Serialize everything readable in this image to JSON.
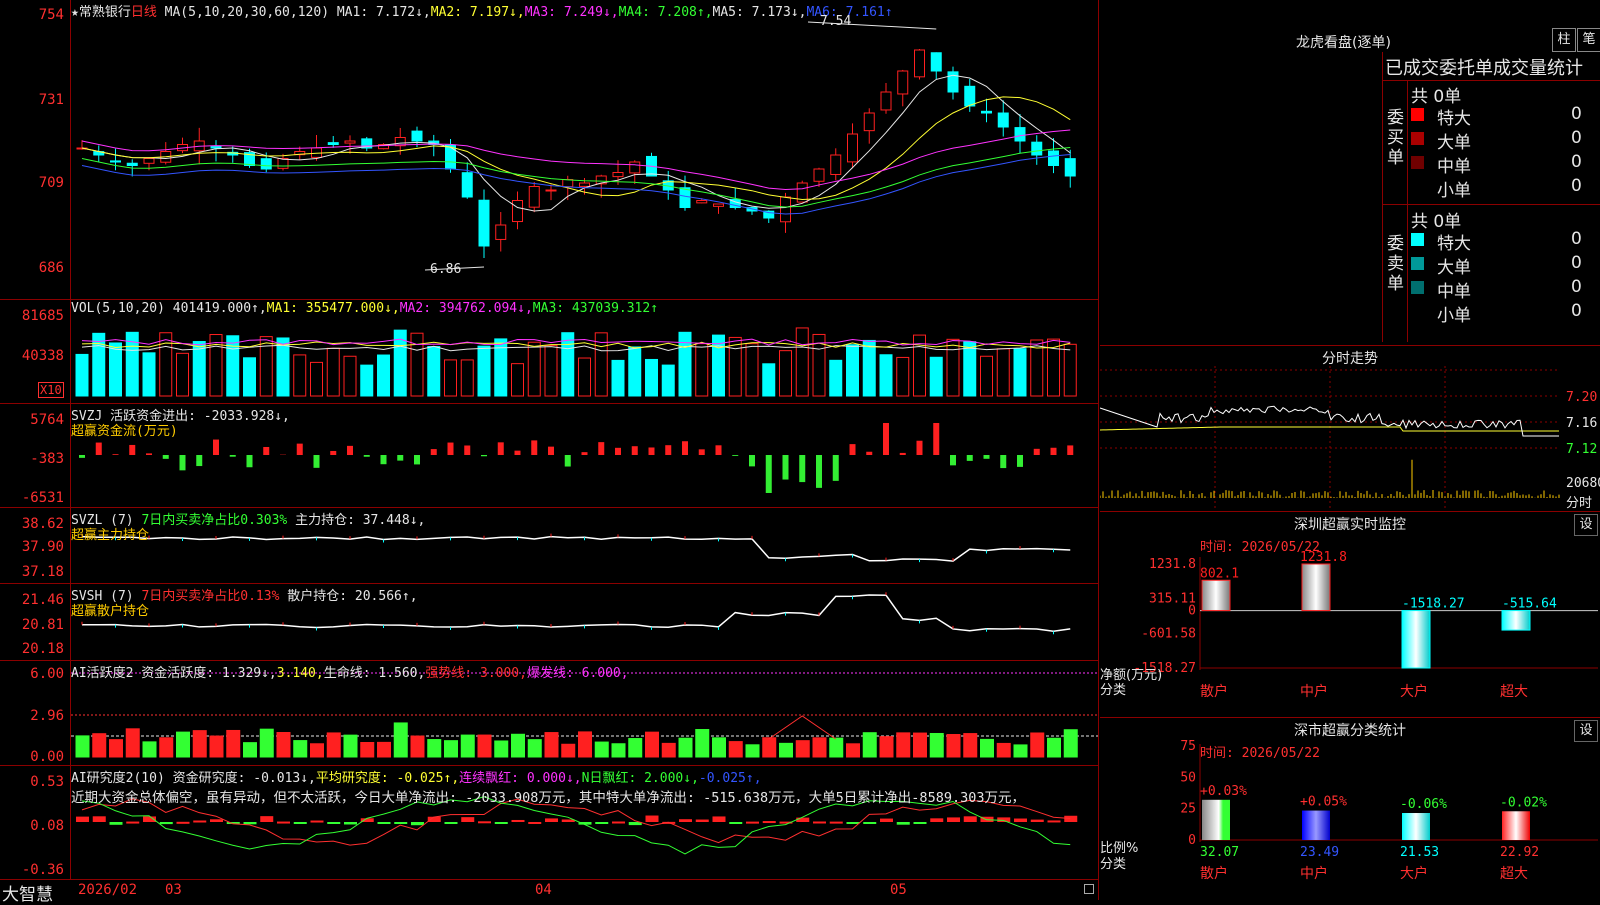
{
  "main": {
    "header": [
      {
        "t": "★常熟银行",
        "c": "w"
      },
      {
        "t": "日线 ",
        "c": "r"
      },
      {
        "t": "MA(5,10,20,30,60,120) ",
        "c": "w"
      },
      {
        "t": "MA1: 7.172↓,",
        "c": "w"
      },
      {
        "t": "MA2: 7.197↓,",
        "c": "y"
      },
      {
        "t": "MA3: 7.249↓,",
        "c": "m"
      },
      {
        "t": "MA4: 7.208↑,",
        "c": "g"
      },
      {
        "t": "MA5: 7.173↓,",
        "c": "w"
      },
      {
        "t": "MA6: 7.161↑",
        "c": "b"
      }
    ],
    "axis": [
      "754",
      "731",
      "709",
      "686"
    ],
    "high_label": "7.54",
    "low_label": "6.86"
  },
  "vol": {
    "header": [
      {
        "t": "VOL(5,10,20) ",
        "c": "w"
      },
      {
        "t": "401419.000↑,",
        "c": "w"
      },
      {
        "t": "MA1: 355477.000↓,",
        "c": "y"
      },
      {
        "t": "MA2: 394762.094↓,",
        "c": "m"
      },
      {
        "t": "MA3: 437039.312↑",
        "c": "g"
      }
    ],
    "axis": [
      "81685",
      "40338"
    ],
    "unit": "X10"
  },
  "svzj": {
    "header": [
      {
        "t": "SVZJ  活跃资金进出: -2033.928↓,",
        "c": "w"
      }
    ],
    "header2": "超赢资金流(万元)",
    "axis": [
      "5764",
      "-383",
      "-6531"
    ]
  },
  "svzl": {
    "header": [
      {
        "t": "SVZL (7) ",
        "c": "w"
      },
      {
        "t": "7日内买卖净占比0.303% ",
        "c": "g"
      },
      {
        "t": "主力持仓: 37.448↓,",
        "c": "w"
      }
    ],
    "header2": "超赢主力持仓",
    "axis": [
      "38.62",
      "37.90",
      "37.18"
    ]
  },
  "svsh": {
    "header": [
      {
        "t": "SVSH (7) ",
        "c": "w"
      },
      {
        "t": "7日内买卖净占比0.13% ",
        "c": "r"
      },
      {
        "t": "散户持仓: 20.566↑,",
        "c": "w"
      }
    ],
    "header2": "超赢散户持仓",
    "axis": [
      "21.46",
      "20.81",
      "20.18"
    ]
  },
  "ai1": {
    "header": [
      {
        "t": "AI活跃度2 资金活跃度: 1.329↓,",
        "c": "w"
      },
      {
        "t": "3.140,",
        "c": "y"
      },
      {
        "t": "生命线: 1.560,",
        "c": "w"
      },
      {
        "t": "强势线: 3.000,",
        "c": "r"
      },
      {
        "t": "爆发线: 6.000,",
        "c": "m"
      }
    ],
    "axis": [
      "6.00",
      "2.96",
      "0.00"
    ]
  },
  "ai2": {
    "header": [
      {
        "t": "AI研究度2(10) 资金研究度: -0.013↓,",
        "c": "w"
      },
      {
        "t": "平均研究度: -0.025↑,",
        "c": "y"
      },
      {
        "t": "连续飘红: 0.000↓,",
        "c": "m"
      },
      {
        "t": "N日飘红: 2.000↓,",
        "c": "g"
      },
      {
        "t": "-0.025↑,",
        "c": "b"
      }
    ],
    "header2": "近期大资金总体偏空，虽有异动，但不太活跃，今日大单净流出: -2033.908万元，其中特大单净流出: -515.638万元，大单5日累计净出-8589.303万元，",
    "axis": [
      "0.53",
      "0.08",
      "-0.36"
    ]
  },
  "bottom": {
    "brand": "大智慧",
    "dates": [
      "2026/02",
      "03",
      "04",
      "05"
    ]
  },
  "dragon": {
    "title": "龙虎看盘(逐单)",
    "btns": [
      "柱",
      "笔"
    ],
    "subtitle": "已成交委托单成交量统计",
    "buy": {
      "label": "委买单",
      "total": "共 0单",
      "rows": [
        {
          "name": "特大",
          "qty": "0",
          "pct": "0%",
          "color": "#ff0000"
        },
        {
          "name": "大单",
          "qty": "0",
          "pct": "0%",
          "color": "#aa0000"
        },
        {
          "name": "中单",
          "qty": "0",
          "pct": "0%",
          "color": "#700000"
        },
        {
          "name": "小单",
          "qty": "0",
          "pct": "0%",
          "color": "#000000"
        }
      ]
    },
    "sell": {
      "label": "委卖单",
      "total": "共 0单",
      "rows": [
        {
          "name": "特大",
          "qty": "0",
          "pct": "0%",
          "color": "#00ffff"
        },
        {
          "name": "大单",
          "qty": "0",
          "pct": "0%",
          "color": "#009999"
        },
        {
          "name": "中单",
          "qty": "0",
          "pct": "0%",
          "color": "#006f6f"
        },
        {
          "name": "小单",
          "qty": "0",
          "pct": "0%",
          "color": "#000000"
        }
      ]
    }
  },
  "intraday": {
    "title": "分时走势",
    "axis": [
      "7.20",
      "7.16",
      "7.12"
    ],
    "vol_label": "20680",
    "bottom_label": "分时"
  },
  "monitor": {
    "title": "深圳超赢实时监控",
    "set": "设",
    "date": "时间: 2026/05/22",
    "axis": [
      "1231.8",
      "315.11",
      "0",
      "-601.58",
      "-1518.27"
    ],
    "ylabel": "净额(万元)",
    "xlabel": "分类",
    "categories": [
      "散户",
      "中户",
      "大户",
      "超大"
    ],
    "values": [
      802.1,
      1231.8,
      -1518.27,
      -515.64
    ],
    "value_labels": [
      "802.1",
      "1231.8",
      "-1518.27",
      "-515.64"
    ]
  },
  "classify": {
    "title": "深市超赢分类统计",
    "set": "设",
    "date": "时间: 2026/05/22",
    "axis": [
      "75",
      "50",
      "25",
      "0"
    ],
    "ylabel": "比例%",
    "xlabel": "分类",
    "categories": [
      "散户",
      "中户",
      "大户",
      "超大"
    ],
    "values": [
      32.07,
      23.49,
      21.53,
      22.92
    ],
    "value_labels": [
      "32.07",
      "23.49",
      "21.53",
      "22.92"
    ],
    "change_labels": [
      "+0.03%",
      "+0.05%",
      "-0.06%",
      "-0.02%"
    ]
  },
  "colors": {
    "up": "#ff2020",
    "down": "#00ffff",
    "frame": "#8b0000"
  }
}
